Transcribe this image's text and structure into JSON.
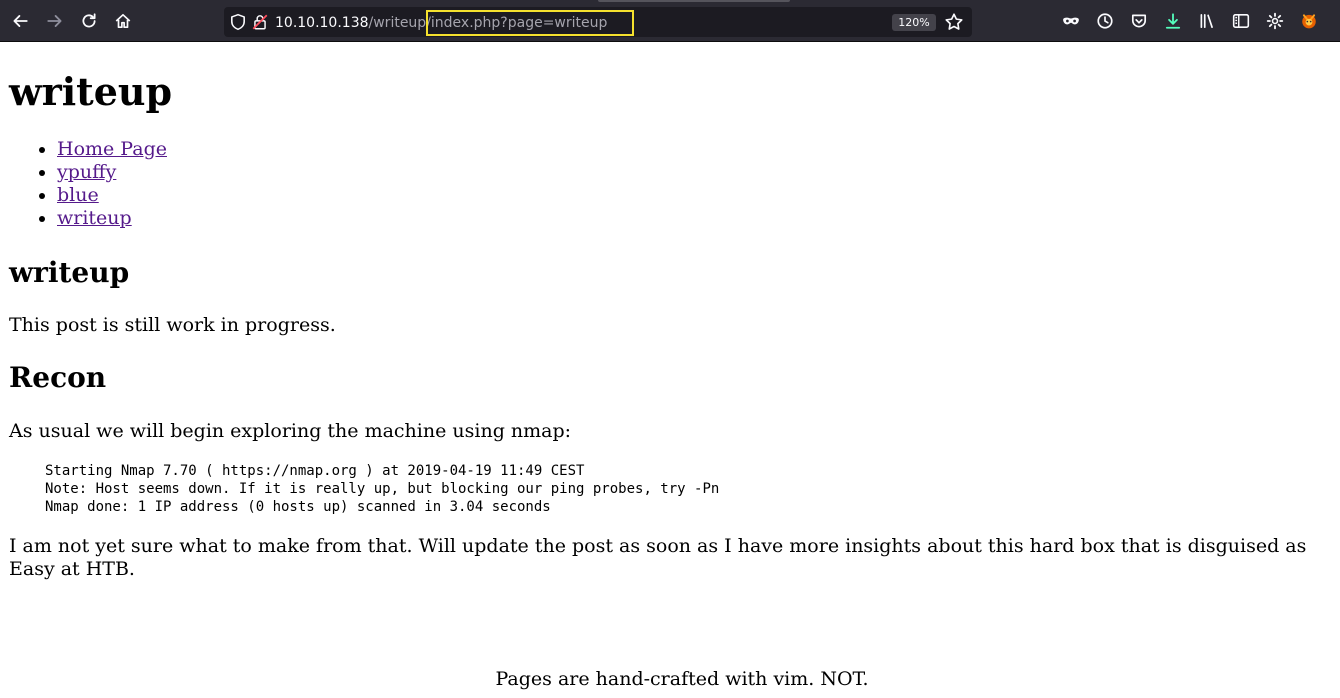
{
  "browser": {
    "url_host": "10.10.10.138",
    "url_path": "/writeup/index.php?page=writeup",
    "zoom": "120%",
    "nav_icons": [
      "back-arrow-icon",
      "forward-arrow-icon",
      "reload-icon",
      "home-icon"
    ],
    "toolbar_icons": [
      "private-browsing-mask-icon",
      "history-clock-icon",
      "pocket-icon",
      "downloads-icon",
      "library-icon",
      "sidebar-icon",
      "settings-gear-icon",
      "extension-fox-icon"
    ],
    "colors": {
      "chrome_bg": "#2b2a33",
      "urlbar_bg": "#1c1b22",
      "highlight": "#f5e12e",
      "download_accent": "#54ffbd"
    }
  },
  "page": {
    "title": "writeup",
    "nav_links": [
      "Home Page",
      "ypuffy",
      "blue",
      "writeup"
    ],
    "post_title": "writeup",
    "intro": "This post is still work in progress.",
    "section_title": "Recon",
    "nmap_intro": "As usual we will begin exploring the machine using nmap:",
    "nmap_output": [
      "Starting Nmap 7.70 ( https://nmap.org ) at 2019-04-19 11:49 CEST",
      "Note: Host seems down. If it is really up, but blocking our ping probes, try -Pn",
      "Nmap done: 1 IP address (0 hosts up) scanned in 3.04 seconds"
    ],
    "conclusion": "I am not yet sure what to make from that. Will update the post as soon as I have more insights about this hard box that is disguised as Easy at HTB.",
    "footer": "Pages are hand-crafted with vim. NOT.",
    "link_color": "#551a8b"
  }
}
